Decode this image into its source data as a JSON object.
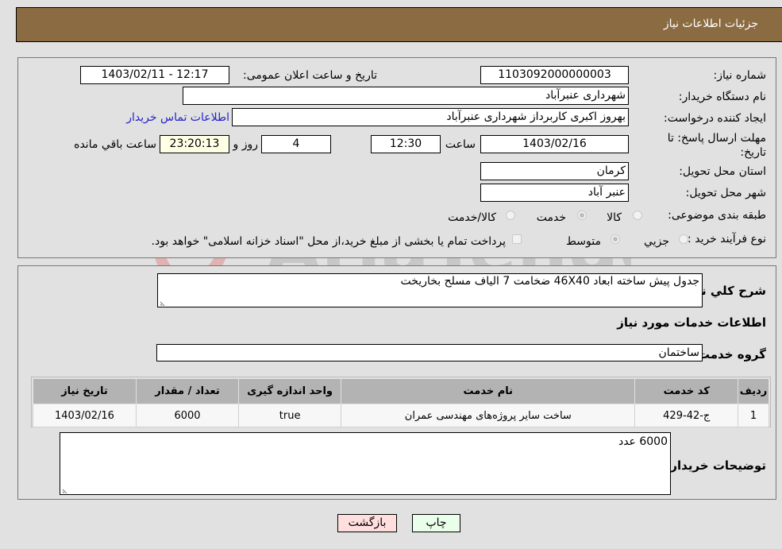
{
  "header": {
    "title": "جزئیات اطلاعات نیاز"
  },
  "details": {
    "need_number": {
      "label": "شماره نیاز:",
      "value": "1103092000000003"
    },
    "announce_datetime": {
      "label": "تاریخ و ساعت اعلان عمومی:",
      "value": "1403/02/11 - 12:17"
    },
    "buyer_org": {
      "label": "نام دستگاه خریدار:",
      "value": "شهرداری عنبرآباد"
    },
    "requester": {
      "label": "ایجاد کننده درخواست:",
      "value": "بهروز اکبری کاربرداز شهرداری عنبرآباد"
    },
    "buyer_contact_link": "اطلاعات تماس خریدار",
    "deadline": {
      "label": "مهلت ارسال پاسخ: تا تاریخ:",
      "date": "1403/02/16",
      "time_label": "ساعت",
      "time": "12:30",
      "days": "4",
      "days_label": "روز و",
      "remaining": "23:20:13",
      "remaining_label": "ساعت باقي مانده"
    },
    "province": {
      "label": "استان محل تحویل:",
      "value": "کرمان"
    },
    "city": {
      "label": "شهر محل تحویل:",
      "value": "عنبر آباد"
    },
    "category": {
      "label": "طبقه بندی موضوعی:",
      "options": [
        "کالا",
        "خدمت",
        "کالا/خدمت"
      ],
      "selected": "خدمت"
    },
    "purchase_type": {
      "label": "نوع فرآیند خرید :",
      "options": [
        "جزیي",
        "متوسط"
      ],
      "selected": "متوسط",
      "treasury_note": "پرداخت تمام یا بخشی از مبلغ خرید،از محل \"اسناد خزانه اسلامی\" خواهد بود."
    }
  },
  "summary": {
    "label": "شرح كلي نياز:",
    "value": "جدول پیش ساخته ابعاد 46X40 ضخامت 7 الیاف مسلح بخاریخت"
  },
  "services_section": {
    "title": "اطلاعات خدمات مورد نیاز",
    "group_label": "گروه خدمت:",
    "group_value": "ساختمان",
    "table": {
      "columns": [
        "ردیف",
        "کد خدمت",
        "نام خدمت",
        "واحد اندازه گیری",
        "تعداد / مقدار",
        "تاریخ نیاز"
      ],
      "rows": [
        [
          "1",
          "ج-42-429",
          "ساخت سایر پروژه‌های مهندسی عمران",
          "true",
          "6000",
          "1403/02/16"
        ]
      ]
    }
  },
  "buyer_notes": {
    "label": "توضیحات خریدار:",
    "value": "6000 عدد"
  },
  "buttons": {
    "print": "چاپ",
    "back": "بازگشت"
  },
  "colors": {
    "header_bg": "#8b6c42",
    "print_bg": "#eaffea",
    "back_bg": "#ffdede",
    "link": "#2222cc"
  }
}
